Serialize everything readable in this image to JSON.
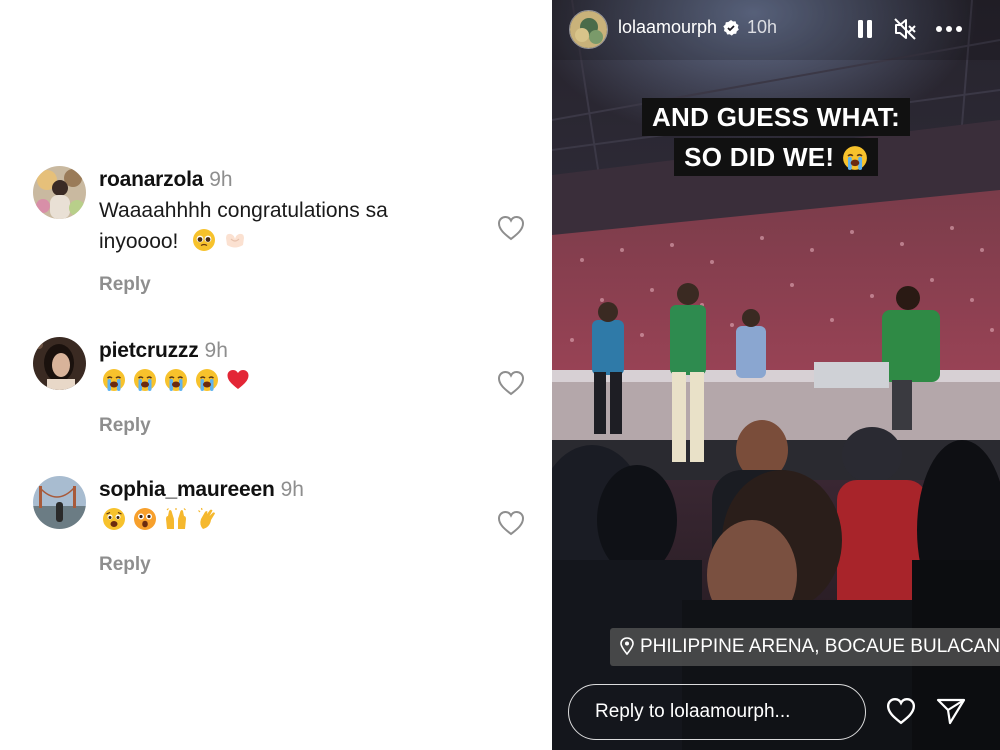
{
  "comments": [
    {
      "username": "roanarzola",
      "time": "9h",
      "text_lines": [
        "Waaaahhhh congratulations sa",
        "inyoooo!"
      ],
      "emojis": [
        "pleading-face-emoji",
        "heart-hands-emoji"
      ],
      "reply_label": "Reply"
    },
    {
      "username": "pietcruzzz",
      "time": "9h",
      "emojis": [
        "loudly-crying-face-emoji",
        "loudly-crying-face-emoji",
        "loudly-crying-face-emoji",
        "loudly-crying-face-emoji",
        "red-heart-emoji"
      ],
      "reply_label": "Reply"
    },
    {
      "username": "sophia_maureeen",
      "time": "9h",
      "emojis": [
        "anguished-face-emoji",
        "astonished-face-emoji",
        "raising-hands-emoji",
        "clapping-hands-emoji"
      ],
      "reply_label": "Reply"
    }
  ],
  "story": {
    "username": "lolaamourph",
    "verified": true,
    "time": "10h",
    "caption_lines": [
      "AND GUESS WHAT:",
      "SO DID WE!"
    ],
    "caption_emoji": "loudly-crying-face-emoji",
    "location": "PHILIPPINE ARENA, BOCAUE BULACAN",
    "reply_placeholder": "Reply to lolaamourph...",
    "icons": [
      "pause-icon",
      "mute-icon",
      "more-icon",
      "heart-icon",
      "send-icon",
      "location-pin-icon"
    ],
    "colors": {
      "caption_bg": "#111111",
      "stage_green": "#2e8b4f"
    }
  }
}
